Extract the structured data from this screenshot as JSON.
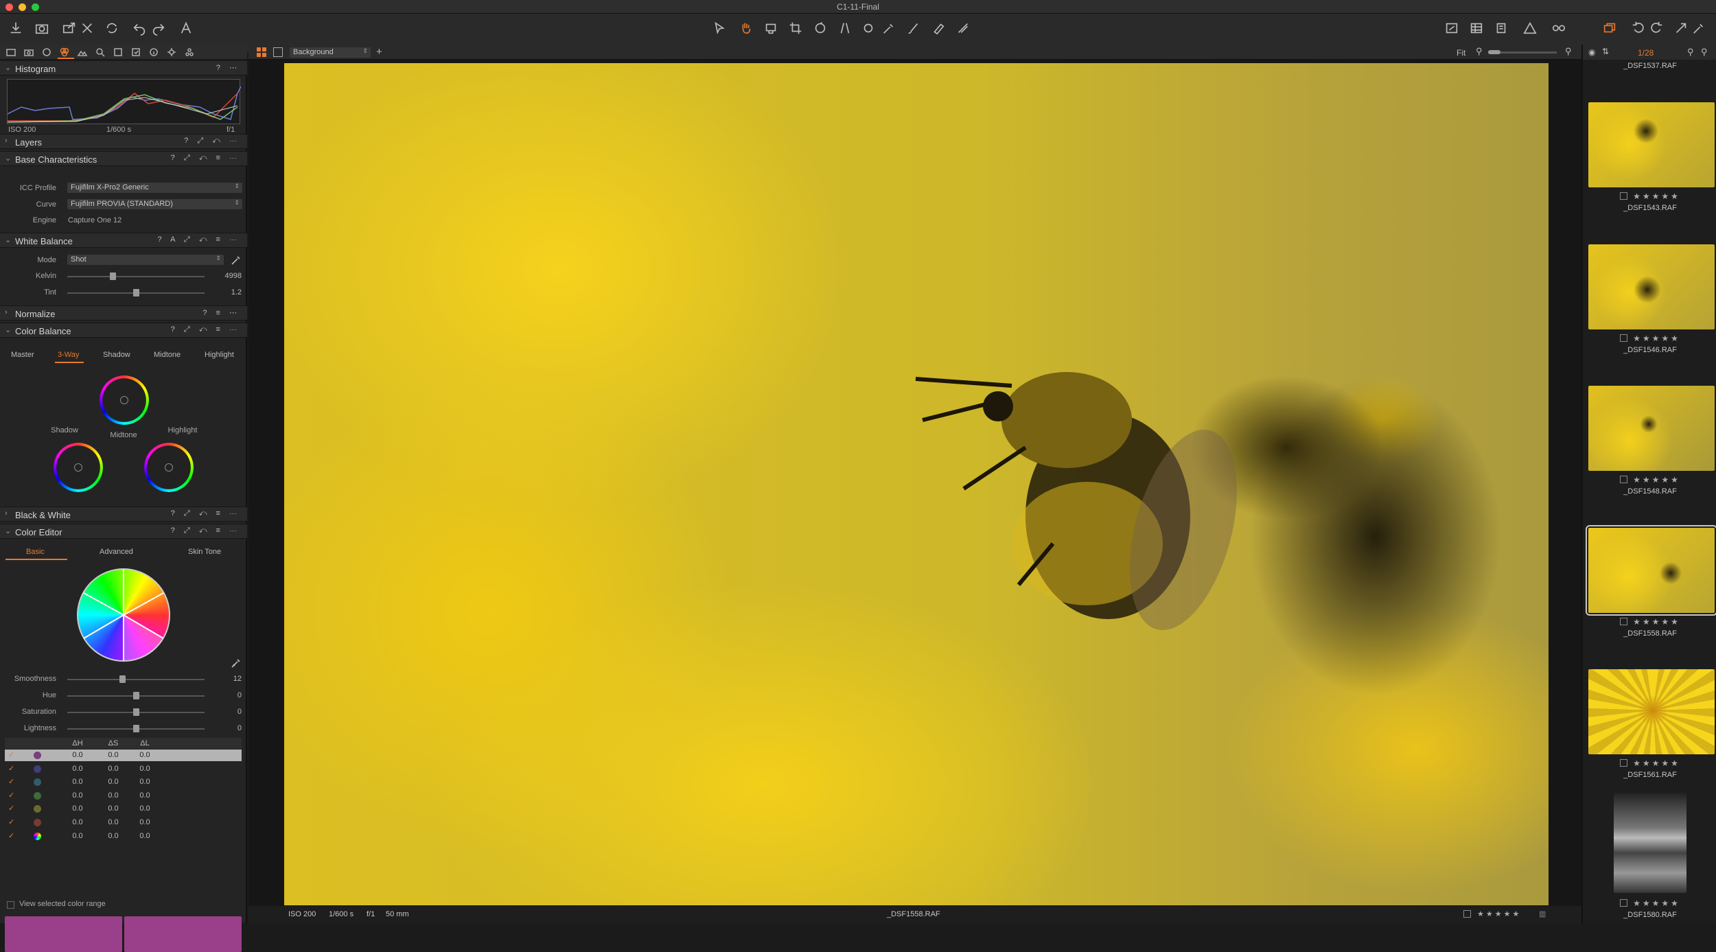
{
  "window": {
    "title": "C1-11-Final"
  },
  "colors": {
    "accent": "#e8792f",
    "panel": "#242424",
    "close": "#ff5f57",
    "minimize": "#febc2e",
    "zoom": "#28c840",
    "swatch": "#9a3f8a"
  },
  "toolbar": {
    "left_icons": [
      "import-icon",
      "capture-icon",
      "export-icon",
      "delete-icon",
      "sync-icon",
      "undo-icon",
      "redo-icon",
      "text-icon"
    ],
    "center_icons": [
      "select-tool-icon",
      "pan-tool-icon",
      "loupe-tool-icon",
      "crop-tool-icon",
      "rotate-tool-icon",
      "keystone-tool-icon",
      "spot-tool-icon",
      "picker-tool-icon",
      "brush-tool-icon",
      "eraser-tool-icon",
      "gradient-tool-icon"
    ],
    "right_icons": [
      "grid-icon",
      "focus-mask-icon",
      "exposure-warning-icon",
      "proof-icon",
      "compare-icon",
      "rotate-left-icon",
      "rotate-right-icon",
      "copy-adjustments-icon",
      "apply-adjustments-icon"
    ]
  },
  "left_panel": {
    "histogram": {
      "title": "Histogram",
      "iso": "ISO 200",
      "shutter": "1/600 s",
      "aperture": "f/1"
    },
    "layers": {
      "title": "Layers"
    },
    "base": {
      "title": "Base Characteristics",
      "icc_label": "ICC Profile",
      "icc_value": "Fujifilm X-Pro2 Generic",
      "curve_label": "Curve",
      "curve_value": "Fujifilm PROVIA (STANDARD)",
      "engine_label": "Engine",
      "engine_value": "Capture One 12"
    },
    "white_balance": {
      "title": "White Balance",
      "mode_label": "Mode",
      "mode_value": "Shot",
      "kelvin_label": "Kelvin",
      "kelvin_value": "4998",
      "kelvin_pos": 0.33,
      "tint_label": "Tint",
      "tint_value": "1.2",
      "tint_pos": 0.5
    },
    "normalize": {
      "title": "Normalize"
    },
    "color_balance": {
      "title": "Color Balance",
      "tabs": [
        "Master",
        "3-Way",
        "Shadow",
        "Midtone",
        "Highlight"
      ],
      "active_tab": "3-Way",
      "wheel_labels": {
        "shadow": "Shadow",
        "midtone": "Midtone",
        "highlight": "Highlight"
      }
    },
    "bw": {
      "title": "Black & White"
    },
    "color_editor": {
      "title": "Color Editor",
      "tabs": [
        "Basic",
        "Advanced",
        "Skin Tone"
      ],
      "active_tab": "Basic",
      "sliders": [
        {
          "label": "Smoothness",
          "value": "12",
          "pos": 0.4
        },
        {
          "label": "Hue",
          "value": "0",
          "pos": 0.5
        },
        {
          "label": "Saturation",
          "value": "0",
          "pos": 0.5
        },
        {
          "label": "Lightness",
          "value": "0",
          "pos": 0.5
        }
      ],
      "columns": [
        "ΔH",
        "ΔS",
        "ΔL"
      ],
      "rows": [
        {
          "color": "#7a3d7e",
          "h": "0.0",
          "s": "0.0",
          "l": "0.0"
        },
        {
          "color": "#3f3d7a",
          "h": "0.0",
          "s": "0.0",
          "l": "0.0"
        },
        {
          "color": "#2f5e6a",
          "h": "0.0",
          "s": "0.0",
          "l": "0.0"
        },
        {
          "color": "#3f6a3a",
          "h": "0.0",
          "s": "0.0",
          "l": "0.0"
        },
        {
          "color": "#6a6a2c",
          "h": "0.0",
          "s": "0.0",
          "l": "0.0"
        },
        {
          "color": "#7a3a32",
          "h": "0.0",
          "s": "0.0",
          "l": "0.0"
        },
        {
          "color": "#888888",
          "h": "0.0",
          "s": "0.0",
          "l": "0.0"
        }
      ],
      "view_range_label": "View selected color range"
    }
  },
  "viewer_bar": {
    "layer_select": "Background",
    "fit_label": "Fit"
  },
  "status": {
    "iso": "ISO 200",
    "shutter": "1/600 s",
    "aperture": "f/1",
    "focal": "50 mm",
    "filename": "_DSF1558.RAF",
    "stars": "★★★★★"
  },
  "browser": {
    "counter": "1/28",
    "top_name": "_DSF1537.RAF",
    "items": [
      {
        "name": "_DSF1543.RAF",
        "stars": "★★★★★"
      },
      {
        "name": "_DSF1546.RAF",
        "stars": "★★★★★"
      },
      {
        "name": "_DSF1548.RAF",
        "stars": "★★★★★"
      },
      {
        "name": "_DSF1558.RAF",
        "stars": "★★★★★"
      },
      {
        "name": "_DSF1561.RAF",
        "stars": "★★★★★"
      },
      {
        "name": "_DSF1580.RAF",
        "stars": "★★★★★"
      }
    ]
  }
}
